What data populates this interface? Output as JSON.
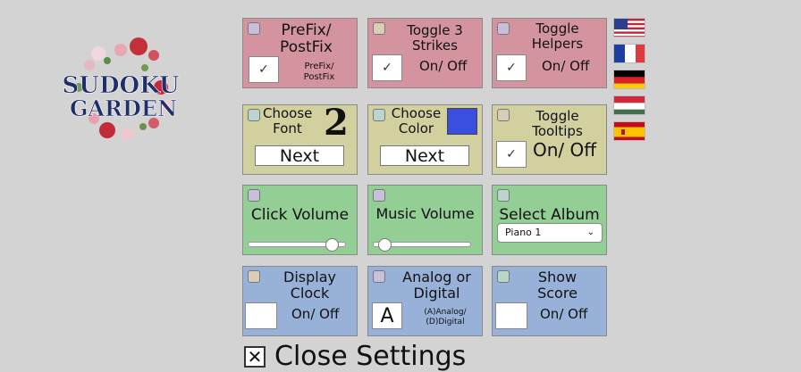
{
  "logo": {
    "line1": "SUDOKU",
    "line2": "GARDEN"
  },
  "cards": {
    "prefix": {
      "title": "PreFix/ PostFix",
      "state": "PreFix/ PostFix",
      "check": "✓"
    },
    "strikes": {
      "title": "Toggle 3 Strikes",
      "state": "On/ Off",
      "check": "✓"
    },
    "helpers": {
      "title": "Toggle Helpers",
      "state": "On/ Off",
      "check": "✓"
    },
    "font": {
      "title": "Choose Font",
      "preview": "2",
      "next": "Next"
    },
    "color": {
      "title": "Choose Color",
      "swatch": "#3a4fe0",
      "next": "Next"
    },
    "tooltips": {
      "title": "Toggle Tooltips",
      "state": "On/ Off",
      "check": "✓"
    },
    "click_volume": {
      "title": "Click Volume",
      "value": 0.94
    },
    "music_volume": {
      "title": "Music Volume",
      "value": 0.08
    },
    "album": {
      "title": "Select Album",
      "selected": "Piano 1"
    },
    "clock": {
      "title": "Display Clock",
      "state": "On/ Off",
      "check": ""
    },
    "analog": {
      "title": "Analog or Digital",
      "value": "A",
      "hint": "(A)Analog/ (D)Digital"
    },
    "score": {
      "title": "Show Score",
      "state": "On/ Off",
      "check": ""
    }
  },
  "languages": [
    {
      "name": "us-flag-icon"
    },
    {
      "name": "france-flag-icon"
    },
    {
      "name": "germany-flag-icon"
    },
    {
      "name": "hungary-flag-icon"
    },
    {
      "name": "spain-flag-icon"
    }
  ],
  "close": {
    "mark": "✕",
    "label": "Close Settings"
  }
}
